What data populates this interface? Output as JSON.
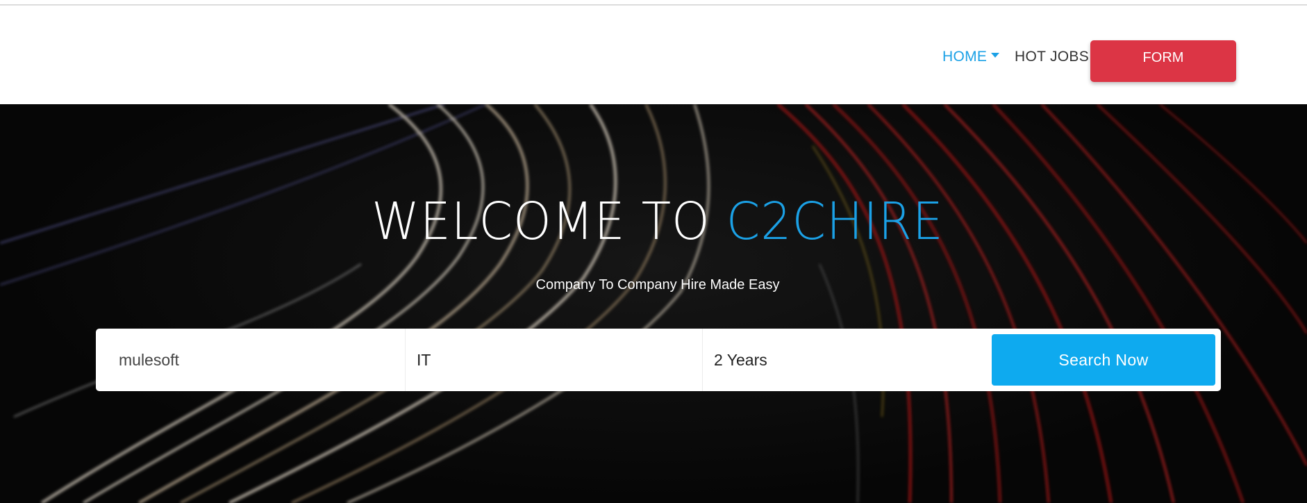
{
  "nav": {
    "home_label": "HOME",
    "hot_jobs_label": "HOT JOBS",
    "form_label": "FORM"
  },
  "hero": {
    "title_prefix": "WELCOME TO ",
    "title_accent": "C2CHIRE",
    "subtitle": "Company To Company Hire Made Easy"
  },
  "search": {
    "keyword_value": "mulesoft",
    "category_value": "IT",
    "experience_value": "2 Years",
    "button_label": "Search Now"
  },
  "colors": {
    "accent_blue": "#1ba1e6",
    "form_red": "#dc3545",
    "search_button": "#0eaaef"
  }
}
